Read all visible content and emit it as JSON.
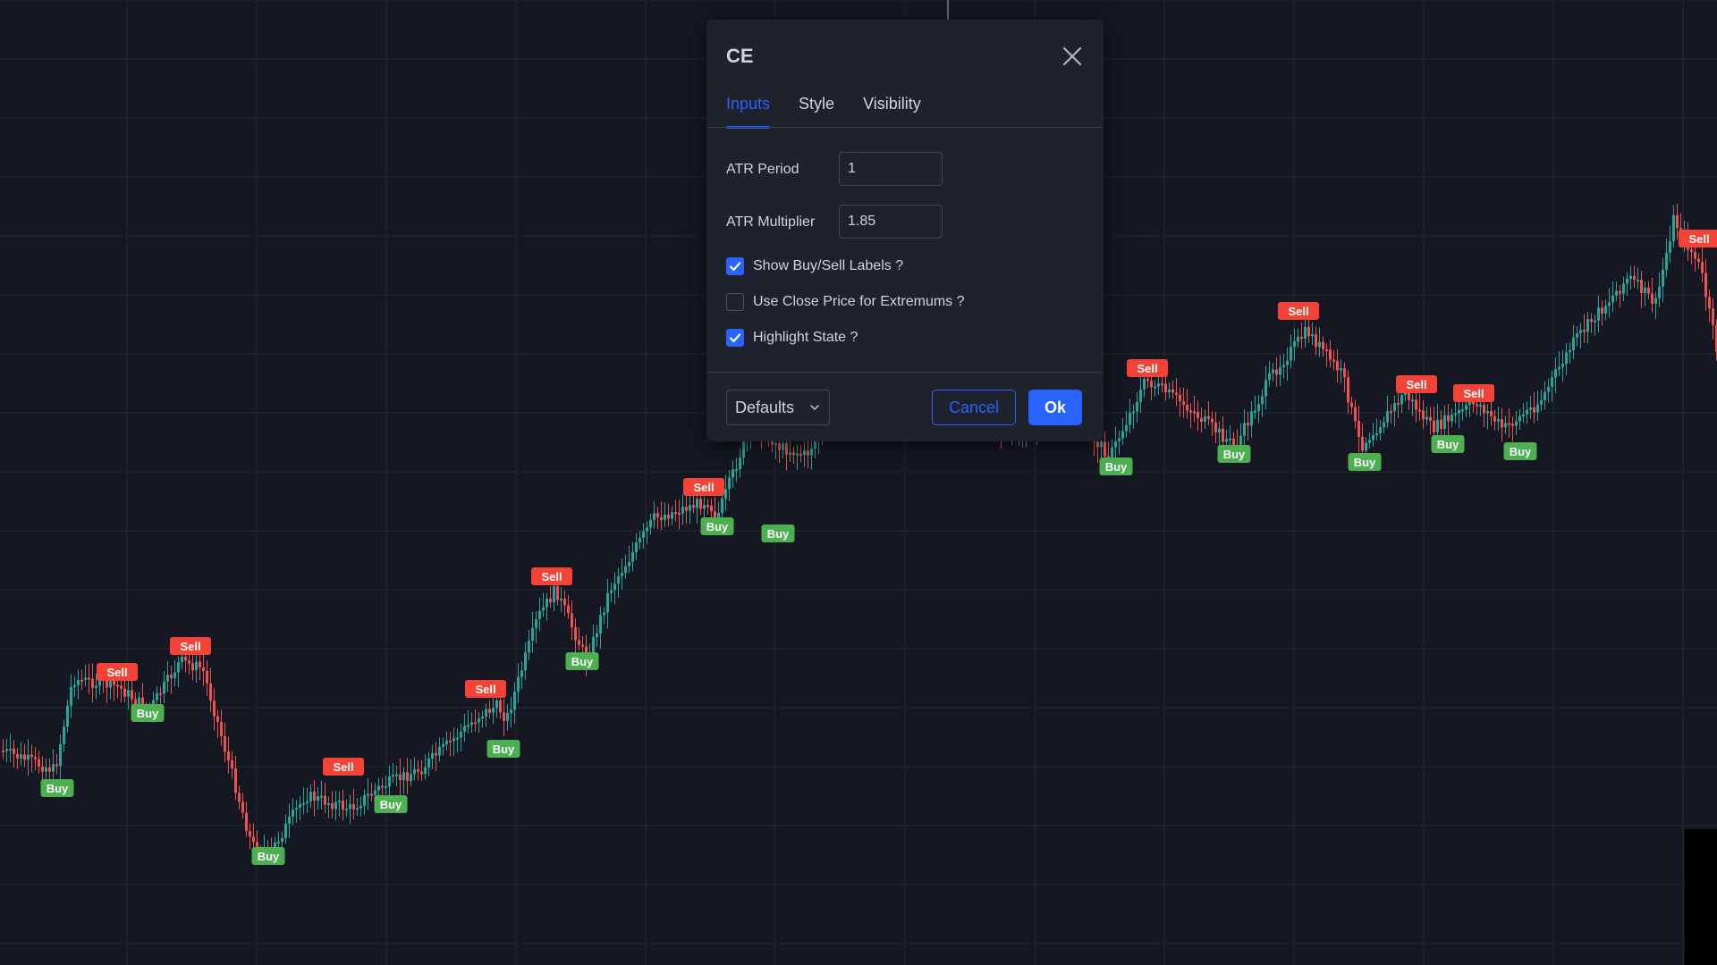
{
  "dialog": {
    "title": "CE",
    "tabs": [
      {
        "label": "Inputs",
        "active": true
      },
      {
        "label": "Style",
        "active": false
      },
      {
        "label": "Visibility",
        "active": false
      }
    ],
    "inputs": {
      "atr_period": {
        "label": "ATR Period",
        "value": "1"
      },
      "atr_multiplier": {
        "label": "ATR Multiplier",
        "value": "1.85"
      }
    },
    "checkboxes": [
      {
        "label": "Show Buy/Sell Labels ?",
        "checked": true
      },
      {
        "label": "Use Close Price for Extremums ?",
        "checked": false
      },
      {
        "label": "Highlight State ?",
        "checked": true
      }
    ],
    "footer": {
      "defaults_label": "Defaults",
      "cancel_label": "Cancel",
      "ok_label": "Ok"
    }
  },
  "chart": {
    "colors": {
      "background": "#151822",
      "grid": "#232733",
      "up": "#26a69a",
      "down": "#ef5350",
      "buy_label": "#4caf50",
      "sell_label": "#f44336",
      "accent": "#2962ff"
    },
    "buy_label_text": "Buy",
    "sell_label_text": "Sell"
  }
}
